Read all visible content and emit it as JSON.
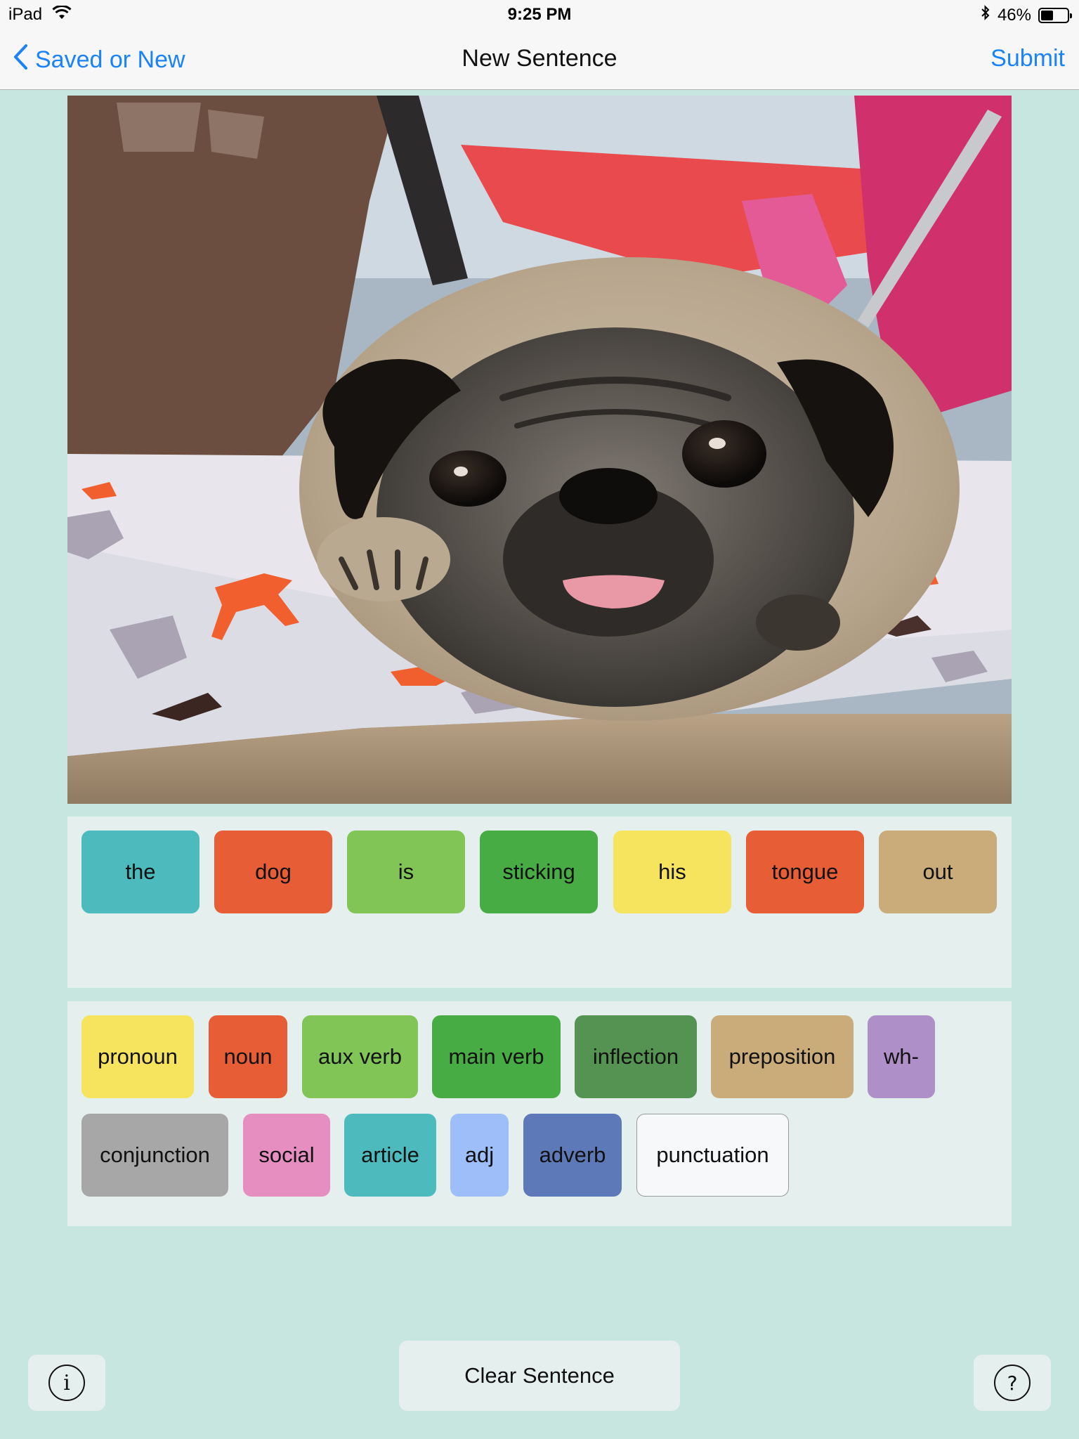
{
  "status_bar": {
    "device": "iPad",
    "time": "9:25 PM",
    "battery_percent": "46%",
    "battery_level": 0.46
  },
  "nav": {
    "back_label": "Saved or New",
    "title": "New Sentence",
    "submit_label": "Submit"
  },
  "sentence": {
    "words": [
      {
        "text": "the",
        "color": "#4dbbbe"
      },
      {
        "text": "dog",
        "color": "#e75d36"
      },
      {
        "text": "is",
        "color": "#80c556"
      },
      {
        "text": "sticking",
        "color": "#47ac43"
      },
      {
        "text": "his",
        "color": "#f6e45e"
      },
      {
        "text": "tongue",
        "color": "#e75d36"
      },
      {
        "text": "out",
        "color": "#c9ac79"
      }
    ]
  },
  "categories": [
    {
      "label": "pronoun",
      "color": "#f6e45e"
    },
    {
      "label": "noun",
      "color": "#e75d36"
    },
    {
      "label": "aux verb",
      "color": "#80c556"
    },
    {
      "label": "main verb",
      "color": "#47ac43"
    },
    {
      "label": "inflection",
      "color": "#559352"
    },
    {
      "label": "preposition",
      "color": "#c9ac79"
    },
    {
      "label": "wh-",
      "color": "#ae8fc8"
    },
    {
      "label": "conjunction",
      "color": "#a7a7a7"
    },
    {
      "label": "social",
      "color": "#e68ebf"
    },
    {
      "label": "article",
      "color": "#4dbbbe"
    },
    {
      "label": "adj",
      "color": "#9dbef9"
    },
    {
      "label": "adverb",
      "color": "#5d79b7"
    },
    {
      "label": "punctuation",
      "color": "#f7f8f9"
    }
  ],
  "bottom": {
    "info_glyph": "i",
    "clear_label": "Clear Sentence",
    "help_glyph": "?"
  }
}
